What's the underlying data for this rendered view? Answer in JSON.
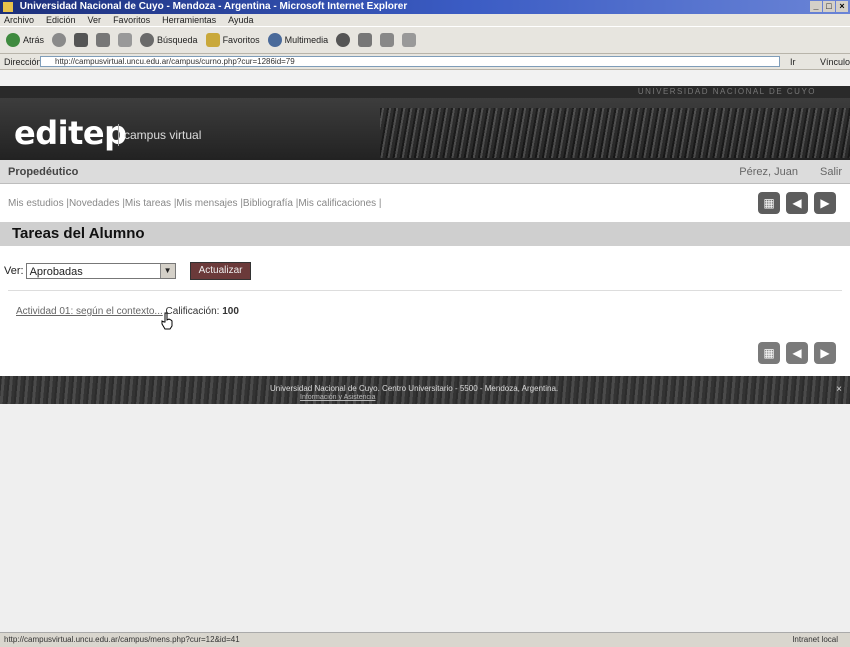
{
  "browser": {
    "title": "Universidad Nacional de Cuyo - Mendoza - Argentina - Microsoft Internet Explorer",
    "menu": [
      "Archivo",
      "Edición",
      "Ver",
      "Favoritos",
      "Herramientas",
      "Ayuda"
    ],
    "toolbar": {
      "back": "Atrás",
      "search": "Búsqueda",
      "favorites": "Favoritos",
      "multimedia": "Multimedia"
    },
    "address_label": "Dirección",
    "address_value": "http://campusvirtual.uncu.edu.ar/campus/curno.php?cur=1286id=79",
    "go_label": "Ir",
    "links_label": "Vínculos",
    "window_buttons": [
      "_",
      "□",
      "×"
    ]
  },
  "page": {
    "university": "UNIVERSIDAD NACIONAL DE CUYO",
    "logo": "editep",
    "logo_sub": "campus virtual",
    "course": "Propedéutico",
    "user": "Pérez, Juan",
    "logout": "Salir",
    "nav_links": "Mis estudios |Novedades |Mis tareas |Mis mensajes |Bibliografía |Mis calificaciones |",
    "section_title": "Tareas del Alumno",
    "filter_label": "Ver:",
    "filter_value": "Aprobadas",
    "update_button": "Actualizar",
    "tasks": [
      {
        "name": "Actividad 01: según el contexto...",
        "grade_label": "Calificación:",
        "grade": "100"
      }
    ],
    "footer_text": "Universidad Nacional de Cuyo. Centro Universitario - 5500 - Mendoza, Argentina.",
    "footer_link": "Información y Asistencia",
    "footer_close": "×"
  },
  "status": {
    "url": "http://campusvirtual.uncu.edu.ar/campus/mens.php?cur=12&id=41",
    "zone": "Intranet local"
  }
}
